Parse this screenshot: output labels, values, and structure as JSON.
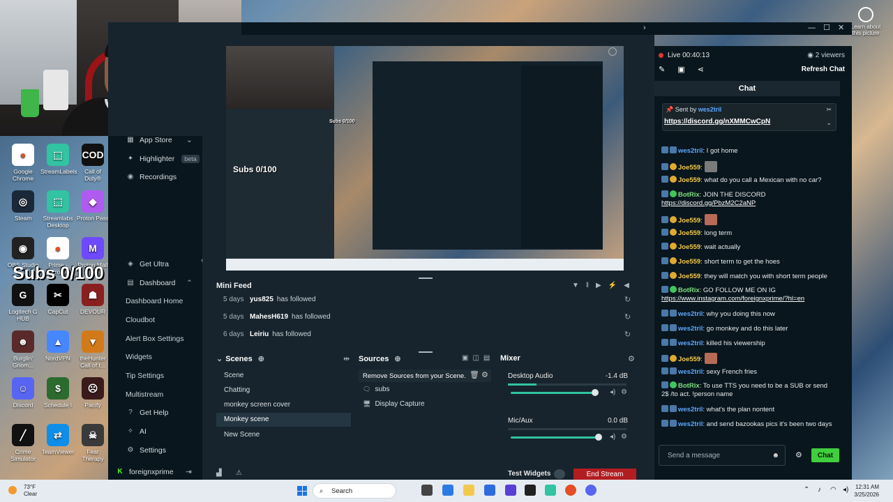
{
  "webcam": {},
  "desktop": {
    "icons": [
      {
        "label": "Google Chrome",
        "color": "#ffffff",
        "glyph": "●"
      },
      {
        "label": "StreamLabels",
        "color": "#31c3a2",
        "glyph": "⬚"
      },
      {
        "label": "Call of Duty®",
        "color": "#111111",
        "glyph": "COD"
      },
      {
        "label": "Steam",
        "color": "#1b2838",
        "glyph": "◎"
      },
      {
        "label": "Streamlabs Desktop",
        "color": "#31c3a2",
        "glyph": "⬚"
      },
      {
        "label": "Proton Pass",
        "color": "#b05bf0",
        "glyph": "◆"
      },
      {
        "label": "OBS Studio",
        "color": "#222222",
        "glyph": "◉"
      },
      {
        "label": "Prime - Chrome",
        "color": "#ffffff",
        "glyph": "●"
      },
      {
        "label": "Proton Mail",
        "color": "#6d4aff",
        "glyph": "M"
      },
      {
        "label": "Logitech G HUB",
        "color": "#111111",
        "glyph": "G"
      },
      {
        "label": "CapCut",
        "color": "#000000",
        "glyph": "✂"
      },
      {
        "label": "DEVOUR",
        "color": "#8a1f1f",
        "glyph": "☗"
      },
      {
        "label": "Burglin' Gnom...",
        "color": "#5a2a2a",
        "glyph": "☻"
      },
      {
        "label": "NordVPN",
        "color": "#4687ff",
        "glyph": "▲"
      },
      {
        "label": "theHunter Call of t...",
        "color": "#d27a1a",
        "glyph": "▼"
      },
      {
        "label": "Discord",
        "color": "#5865f2",
        "glyph": "☺"
      },
      {
        "label": "Schedule I",
        "color": "#2c6b2f",
        "glyph": "$"
      },
      {
        "label": "Pacify",
        "color": "#3a1a1a",
        "glyph": "☹"
      },
      {
        "label": "Crime Simulator",
        "color": "#111111",
        "glyph": "╱"
      },
      {
        "label": "TeamViewer",
        "color": "#0e8ee9",
        "glyph": "⇄"
      },
      {
        "label": "Fear Therapy",
        "color": "#3a3a3a",
        "glyph": "☠"
      }
    ],
    "subs_overlay": "Subs 0/100",
    "learn_about": "Learn about this picture"
  },
  "sidebar": {
    "app_store": "App Store",
    "highlighter": "Highlighter",
    "beta": "beta",
    "recordings": "Recordings",
    "get_ultra": "Get Ultra",
    "dashboard": "Dashboard",
    "dashboard_home": "Dashboard Home",
    "cloudbot": "Cloudbot",
    "alert_box": "Alert Box Settings",
    "widgets": "Widgets",
    "tip_settings": "Tip Settings",
    "multistream": "Multistream",
    "get_help": "Get Help",
    "ai": "AI",
    "settings": "Settings",
    "username": "foreignxprime"
  },
  "preview": {
    "mini_subs": "Subs 0/100",
    "mini_subs2": "Subs 0/100"
  },
  "minifeed": {
    "title": "Mini Feed",
    "rows": [
      {
        "when": "5 days",
        "who": "yus825",
        "what": "has followed"
      },
      {
        "when": "5 days",
        "who": "MahesH619",
        "what": "has followed"
      },
      {
        "when": "6 days",
        "who": "Leiriu",
        "what": "has followed"
      }
    ]
  },
  "scenes": {
    "title": "Scenes",
    "items": [
      "Scene",
      "Chatting",
      "monkey screen cover",
      "Monkey scene",
      "New Scene"
    ],
    "active_index": 3
  },
  "sources": {
    "title": "Sources",
    "tooltip": "Remove Sources from your Scene.",
    "items": [
      "subs",
      "Display Capture"
    ]
  },
  "mixer": {
    "title": "Mixer",
    "tracks": [
      {
        "name": "Desktop Audio",
        "db": "-1.4 dB",
        "level": 0.96
      },
      {
        "name": "Mic/Aux",
        "db": "0.0 dB",
        "level": 1.0
      }
    ]
  },
  "bottom": {
    "test_widgets": "Test Widgets",
    "end_stream": "End Stream"
  },
  "chat": {
    "live": "Live 00:40:13",
    "viewers": "2 viewers",
    "refresh": "Refresh Chat",
    "tab": "Chat",
    "pinned_by": "Sent by",
    "pinned_user": "wes2tril",
    "pinned_link": "https://discord.gg/nXMMCwCpN",
    "messages": [
      {
        "user": "wes2tril",
        "kind": "wes",
        "text": "I got home"
      },
      {
        "user": "Joe559",
        "kind": "joe",
        "text": "",
        "emote": true
      },
      {
        "user": "Joe559",
        "kind": "joe",
        "text": "what do you call a Mexican with no car?"
      },
      {
        "user": "BotRix",
        "kind": "bot",
        "text": "JOIN THE DISCORD",
        "link": "https://discord.gg/PbzM2C2aNP"
      },
      {
        "user": "Joe559",
        "kind": "joe",
        "text": "",
        "emote": true
      },
      {
        "user": "Joe559",
        "kind": "joe",
        "text": "long term"
      },
      {
        "user": "Joe559",
        "kind": "joe",
        "text": "wait actually"
      },
      {
        "user": "Joe559",
        "kind": "joe",
        "text": "short term to get the hoes"
      },
      {
        "user": "Joe559",
        "kind": "joe",
        "text": "they will match you with short term people"
      },
      {
        "user": "BotRix",
        "kind": "bot",
        "text": "GO FOLLOW ME ON IG",
        "link": "https://www.instagram.com/foreignxprime/?hl=en"
      },
      {
        "user": "wes2tril",
        "kind": "wes",
        "text": "why you doing this now"
      },
      {
        "user": "wes2tril",
        "kind": "wes",
        "text": "go monkey and do this later"
      },
      {
        "user": "wes2tril",
        "kind": "wes",
        "text": "killed his viewership"
      },
      {
        "user": "Joe559",
        "kind": "joe",
        "text": "",
        "emote": true
      },
      {
        "user": "wes2tril",
        "kind": "wes",
        "text": "sexy French fries"
      },
      {
        "user": "BotRix",
        "kind": "bot",
        "text": "To use TTS you need to be a SUB or send 2$ /to act. !person name"
      },
      {
        "user": "wes2tril",
        "kind": "wes",
        "text": "what's the plan nontent"
      },
      {
        "user": "wes2tril",
        "kind": "wes",
        "text": "and send bazookas pics it's been two days"
      }
    ],
    "input_placeholder": "Send a message",
    "send": "Chat"
  },
  "taskbar": {
    "temp": "73°F",
    "weather": "Clear",
    "search": "Search",
    "time": "12:31 AM",
    "date": "3/25/2026"
  }
}
